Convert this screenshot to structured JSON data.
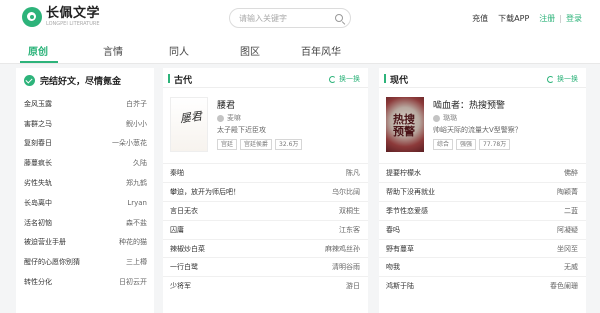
{
  "header": {
    "logo_title": "长佩文学",
    "logo_subtitle": "LONGPEI LITERATURE",
    "search_placeholder": "请输入关键字",
    "links": {
      "recharge": "充值",
      "download": "下载APP",
      "register": "注册",
      "separator": "|",
      "login": "登录"
    }
  },
  "nav": {
    "items": [
      "原创",
      "言情",
      "同人",
      "图区",
      "百年风华"
    ],
    "active_index": 0
  },
  "ranking": {
    "title": "完结好文，尽情氪金",
    "items": [
      {
        "title": "金风玉露",
        "author": "白芥子"
      },
      {
        "title": "害群之马",
        "author": "鲵小小"
      },
      {
        "title": "复刻春日",
        "author": "一朵小葱花"
      },
      {
        "title": "藤蔓疯长",
        "author": "久陆"
      },
      {
        "title": "劣性失轨",
        "author": "郑九鹤"
      },
      {
        "title": "长岛离中",
        "author": "Lryan"
      },
      {
        "title": "活名初恼",
        "author": "森不盐"
      },
      {
        "title": "被迫营业手册",
        "author": "种花的猫"
      },
      {
        "title": "醒仔的心愿你别猜",
        "author": "三上樽"
      },
      {
        "title": "转性分化",
        "author": "日初云开"
      }
    ]
  },
  "ancient": {
    "title": "古代",
    "refresh": "换一换",
    "featured": {
      "title": "腰君",
      "cover_text": "屡君",
      "author": "麦嘛",
      "desc": "太子殿下近臣攻",
      "tags": [
        "宫廷",
        "宫廷侯爵",
        "32.6万"
      ]
    },
    "list": [
      {
        "title": "秦啪",
        "author": "陈凡"
      },
      {
        "title": "攀迫，放开为师后吧！",
        "author": "乌尔比阔"
      },
      {
        "title": "言日无衣",
        "author": "双桐生"
      },
      {
        "title": "囚庸",
        "author": "江东客"
      },
      {
        "title": "辣椒炒白菜",
        "author": "麻辣鸡丝孙"
      },
      {
        "title": "一行白鹭",
        "author": "清明谷雨"
      },
      {
        "title": "少将军",
        "author": "游日"
      }
    ]
  },
  "modern": {
    "title": "现代",
    "refresh": "换一换",
    "featured": {
      "title": "啮血者：热搜预警",
      "cover_text": "热搜预警",
      "author": "璐璐",
      "desc": "帅峪天际的流量大V型警察？",
      "tags": [
        "综合",
        "强强",
        "77.78万"
      ]
    },
    "list": [
      {
        "title": "提要柠檬水",
        "author": "佛醉"
      },
      {
        "title": "帮助下没再就业",
        "author": "陶颖菁"
      },
      {
        "title": "季节性恋爱感",
        "author": "二蓝"
      },
      {
        "title": "春吗",
        "author": "阿凝疑"
      },
      {
        "title": "野有蔓草",
        "author": "坐冈至"
      },
      {
        "title": "吻我",
        "author": "无威"
      },
      {
        "title": "鸿斯于陆",
        "author": "春色阑珊"
      }
    ]
  }
}
